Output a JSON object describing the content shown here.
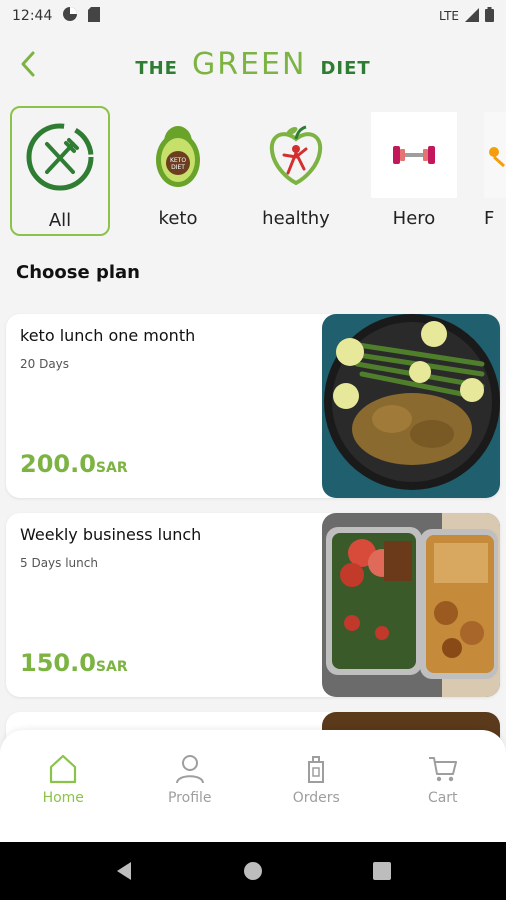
{
  "status_bar": {
    "time": "12:44",
    "network": "LTE"
  },
  "header": {
    "brand_left": "THE",
    "brand_center": "GREEN",
    "brand_right": "DIET"
  },
  "categories": [
    {
      "label": "All",
      "icon": "fork-knife-icon",
      "active": true
    },
    {
      "label": "keto",
      "icon": "avocado-keto-icon",
      "active": false
    },
    {
      "label": "healthy",
      "icon": "apple-heart-icon",
      "active": false
    },
    {
      "label": "Hero",
      "icon": "dumbbell-icon",
      "active": false
    },
    {
      "label": "F",
      "icon": "partial-icon",
      "active": false
    }
  ],
  "section_title": "Choose plan",
  "plans": [
    {
      "name": "keto lunch one month",
      "duration": "20 Days",
      "price": "200.0",
      "currency": "SAR"
    },
    {
      "name": "Weekly business lunch",
      "duration": "5 Days lunch",
      "price": "150.0",
      "currency": "SAR"
    }
  ],
  "bottom_nav": [
    {
      "label": "Home",
      "icon": "home-icon",
      "active": true
    },
    {
      "label": "Profile",
      "icon": "person-icon",
      "active": false
    },
    {
      "label": "Orders",
      "icon": "orders-icon",
      "active": false
    },
    {
      "label": "Cart",
      "icon": "cart-icon",
      "active": false
    }
  ],
  "colors": {
    "accent": "#8bc34a",
    "brand_dark": "#2e7d32",
    "price": "#7cb342"
  }
}
